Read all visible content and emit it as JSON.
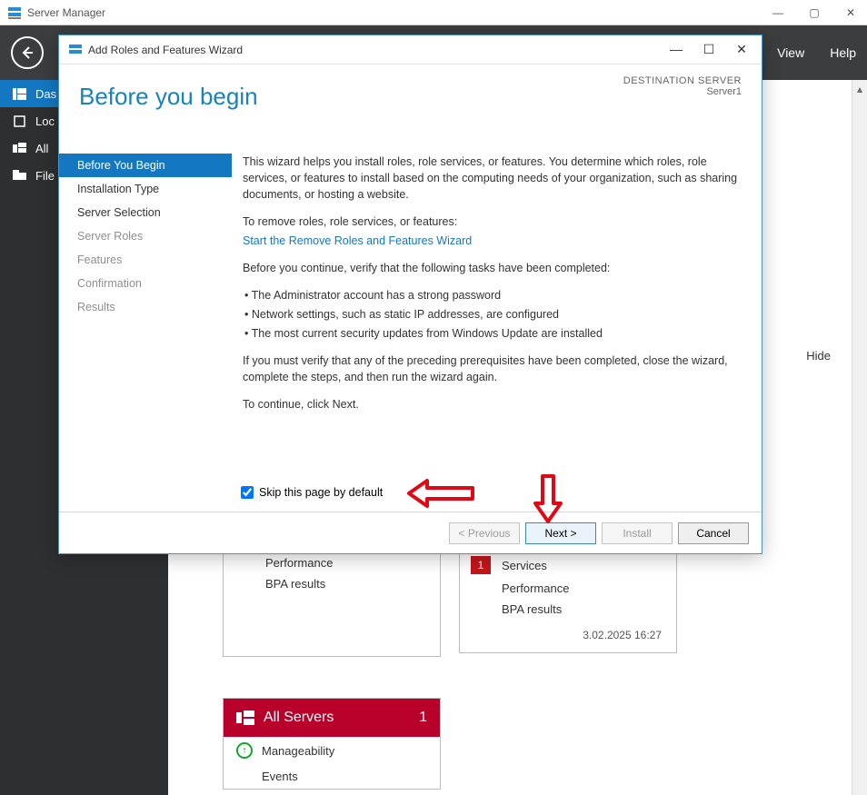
{
  "main_window": {
    "title": "Server Manager",
    "topnav_items": {
      "view": "View",
      "help": "Help"
    },
    "sidebar": {
      "items": [
        {
          "label": "Das"
        },
        {
          "label": "Loc"
        },
        {
          "label": "All"
        },
        {
          "label": "File"
        }
      ]
    },
    "hide_label": "Hide"
  },
  "tiles": {
    "left": {
      "rows": [
        "Performance",
        "BPA results"
      ]
    },
    "right": {
      "rows": [
        {
          "badge": "1",
          "label": "Services"
        },
        {
          "label": "Performance"
        },
        {
          "label": "BPA results"
        }
      ],
      "timestamp": "3.02.2025 16:27"
    }
  },
  "allservers": {
    "title": "All Servers",
    "count": "1",
    "rows": [
      "Manageability",
      "Events"
    ]
  },
  "dialog": {
    "title": "Add Roles and Features Wizard",
    "heading": "Before you begin",
    "destination_label": "DESTINATION SERVER",
    "destination_value": "Server1",
    "steps": [
      {
        "label": "Before You Begin",
        "state": "active"
      },
      {
        "label": "Installation Type",
        "state": "enabled"
      },
      {
        "label": "Server Selection",
        "state": "enabled"
      },
      {
        "label": "Server Roles",
        "state": "disabled"
      },
      {
        "label": "Features",
        "state": "disabled"
      },
      {
        "label": "Confirmation",
        "state": "disabled"
      },
      {
        "label": "Results",
        "state": "disabled"
      }
    ],
    "intro": "This wizard helps you install roles, role services, or features. You determine which roles, role services, or features to install based on the computing needs of your organization, such as sharing documents, or hosting a website.",
    "remove_label": "To remove roles, role services, or features:",
    "remove_link": "Start the Remove Roles and Features Wizard",
    "verify_label": "Before you continue, verify that the following tasks have been completed:",
    "bullets": [
      "The Administrator account has a strong password",
      "Network settings, such as static IP addresses, are configured",
      "The most current security updates from Windows Update are installed"
    ],
    "verify_paragraph": "If you must verify that any of the preceding prerequisites have been completed, close the wizard, complete the steps, and then run the wizard again.",
    "continue_label": "To continue, click Next.",
    "skip_label": "Skip this page by default",
    "skip_checked": true,
    "buttons": {
      "previous": "< Previous",
      "next": "Next >",
      "install": "Install",
      "cancel": "Cancel"
    }
  }
}
